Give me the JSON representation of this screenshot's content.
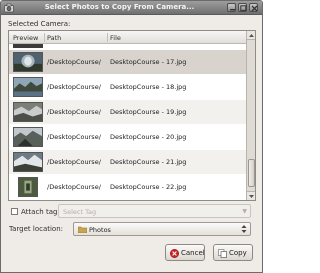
{
  "window": {
    "title": "Select Photos to Copy From Camera..."
  },
  "main": {
    "selected_camera_label": "Selected Camera:",
    "columns": [
      "Preview",
      "Path",
      "File"
    ],
    "rows": [
      {
        "path": "/DesktopCourse/",
        "file": "DesktopCourse - 17.jpg",
        "selected": true
      },
      {
        "path": "/DesktopCourse/",
        "file": "DesktopCourse - 18.jpg",
        "selected": false
      },
      {
        "path": "/DesktopCourse/",
        "file": "DesktopCourse - 19.jpg",
        "selected": false
      },
      {
        "path": "/DesktopCourse/",
        "file": "DesktopCourse - 20.jpg",
        "selected": false
      },
      {
        "path": "/DesktopCourse/",
        "file": "DesktopCourse - 21.jpg",
        "selected": false
      },
      {
        "path": "/DesktopCourse/",
        "file": "DesktopCourse - 22.jpg",
        "selected": false
      }
    ]
  },
  "attach_tag": {
    "label": "Attach tag:",
    "checked": false,
    "placeholder": "Select Tag"
  },
  "target": {
    "label": "Target location:",
    "value": "Photos"
  },
  "buttons": {
    "cancel": "Cancel",
    "copy": "Copy"
  },
  "icons": {
    "title": "camera-icon",
    "folder": "folder-icon",
    "cancel": "cancel-icon",
    "copy": "copy-icon"
  },
  "colors": {
    "titlebar": "#6f6f6f",
    "selected_row": "#d8d3cc",
    "window_bg": "#efebe7"
  }
}
